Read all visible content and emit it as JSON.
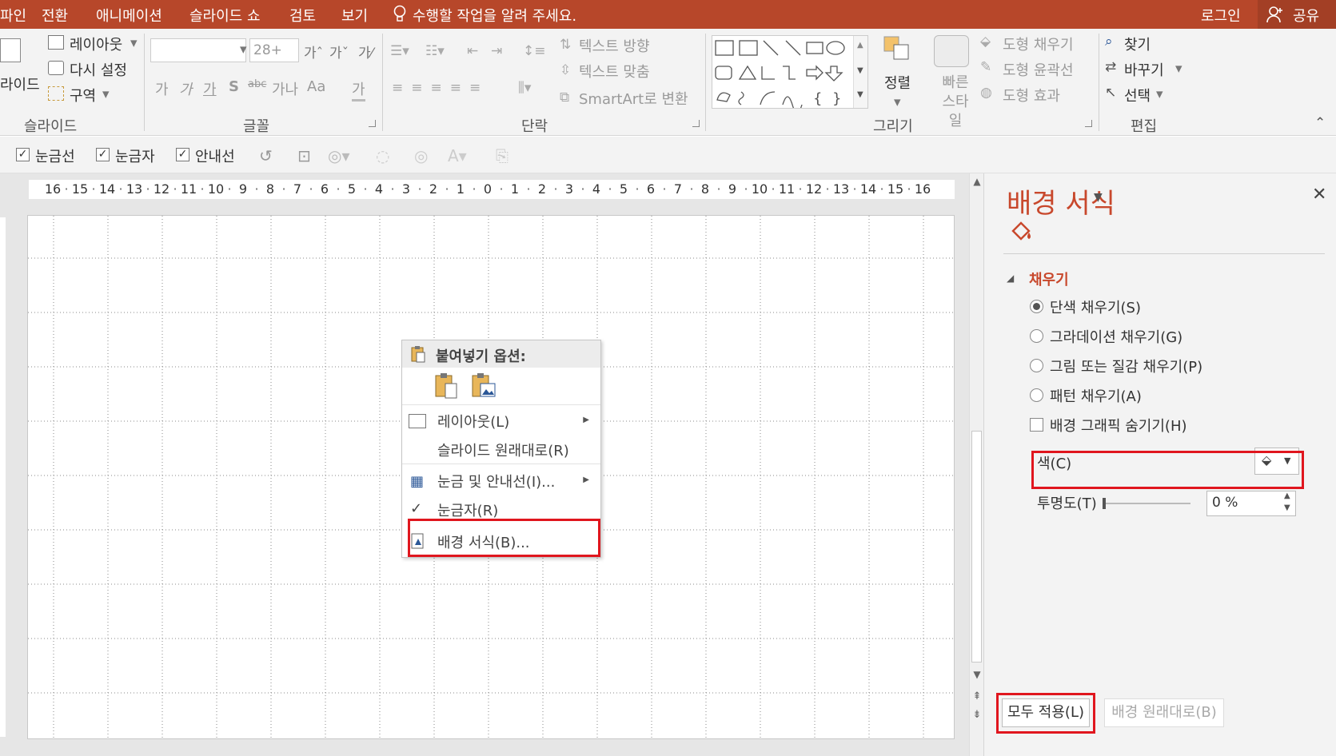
{
  "menu": {
    "tabs": [
      "파인",
      "전환",
      "애니메이션",
      "슬라이드 쇼",
      "검토",
      "보기"
    ],
    "tell_me": "수행할 작업을 알려 주세요.",
    "login": "로그인",
    "share": "공유"
  },
  "ribbon": {
    "slide": {
      "layout": "레이아웃",
      "reset": "다시 설정",
      "section": "구역",
      "new_slide_partial": "라이드",
      "group": "슬라이드"
    },
    "font": {
      "size": "28+",
      "bold_sample": "가",
      "italic_sample": "가",
      "underline_sample": "가",
      "strike": "S",
      "spacing": "가나",
      "case": "Aa",
      "color_sample": "가",
      "group": "글꼴"
    },
    "paragraph": {
      "text_direction": "텍스트 방향",
      "align_text": "텍스트 맞춤",
      "smartart": "SmartArt로 변환",
      "group": "단락"
    },
    "drawing": {
      "arrange": "정렬",
      "quick_styles": "빠른 스타일",
      "shape_fill": "도형 채우기",
      "shape_outline": "도형 윤곽선",
      "shape_effects": "도형 효과",
      "group": "그리기"
    },
    "editing": {
      "find": "찾기",
      "replace": "바꾸기",
      "select": "선택",
      "group": "편집"
    }
  },
  "toolrow": {
    "gridlines": "눈금선",
    "ruler": "눈금자",
    "guides": "안내선"
  },
  "ruler_ticks": [
    "16",
    "15",
    "14",
    "13",
    "12",
    "11",
    "10",
    "9",
    "8",
    "7",
    "6",
    "5",
    "4",
    "3",
    "2",
    "1",
    "0",
    "1",
    "2",
    "3",
    "4",
    "5",
    "6",
    "7",
    "8",
    "9",
    "10",
    "11",
    "12",
    "13",
    "14",
    "15",
    "16"
  ],
  "context_menu": {
    "paste_options": "붙여넣기 옵션:",
    "layout": "레이아웃(L)",
    "reset_slide": "슬라이드 원래대로(R)",
    "grid_guides": "눈금 및 안내선(I)...",
    "ruler": "눈금자(R)",
    "format_background": "배경 서식(B)..."
  },
  "pane": {
    "title": "배경 서식",
    "section": "채우기",
    "options": [
      "단색 채우기(S)",
      "그라데이션 채우기(G)",
      "그림 또는 질감 채우기(P)",
      "패턴 채우기(A)"
    ],
    "selected_option": "단색 채우기(S)",
    "hide_graphics": "배경 그래픽 숨기기(H)",
    "color_label": "색(C)",
    "transparency_label": "투명도(T)",
    "transparency_value": "0 %",
    "apply_all": "모두 적용(L)",
    "reset_background": "배경 원래대로(B)",
    "highlight_color": "#e0161e",
    "accent_color": "#b7472a"
  }
}
